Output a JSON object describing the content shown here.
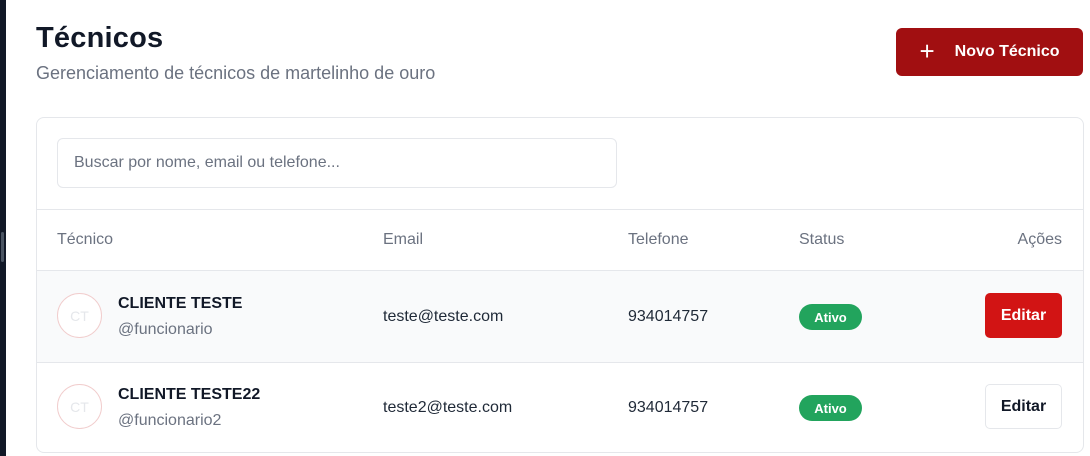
{
  "header": {
    "title": "Técnicos",
    "subtitle": "Gerenciamento de técnicos de martelinho de ouro",
    "new_button_label": "Novo Técnico",
    "new_button_icon": "plus-icon"
  },
  "search": {
    "placeholder": "Buscar por nome, email ou telefone...",
    "value": ""
  },
  "table": {
    "columns": [
      "Técnico",
      "Email",
      "Telefone",
      "Status",
      "Ações"
    ],
    "rows": [
      {
        "initials": "CT",
        "name": "CLIENTE TESTE",
        "username": "@funcionario",
        "email": "teste@teste.com",
        "phone": "934014757",
        "status": "Ativo",
        "action": "Editar"
      },
      {
        "initials": "CT",
        "name": "CLIENTE TESTE22",
        "username": "@funcionario2",
        "email": "teste2@teste.com",
        "phone": "934014757",
        "status": "Ativo",
        "action": "Editar"
      }
    ]
  },
  "colors": {
    "brand": "#a10f11",
    "edit_active": "#d21414",
    "status_active": "#22a45d"
  }
}
